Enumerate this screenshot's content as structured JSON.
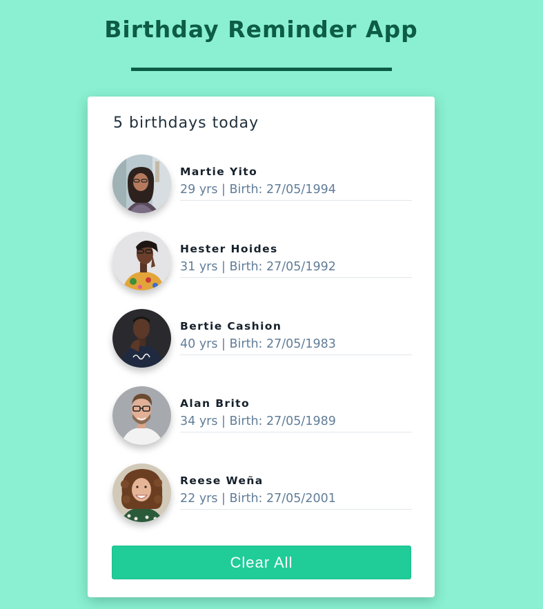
{
  "app": {
    "title": "Birthday Reminder App"
  },
  "summary": {
    "count_text": "5 birthdays today"
  },
  "people": [
    {
      "name": "Martie Yito",
      "info": "29 yrs | Birth: 27/05/1994",
      "avatar_icon": "woman-glasses-street-photo-icon"
    },
    {
      "name": "Hester Hoides",
      "info": "31 yrs | Birth: 27/05/1992",
      "avatar_icon": "woman-colorful-shirt-photo-icon"
    },
    {
      "name": "Bertie Cashion",
      "info": "40 yrs | Birth: 27/05/1983",
      "avatar_icon": "man-dark-tshirt-photo-icon"
    },
    {
      "name": "Alan Brito",
      "info": "34 yrs | Birth: 27/05/1989",
      "avatar_icon": "man-glasses-beard-photo-icon"
    },
    {
      "name": "Reese Weña",
      "info": "22 yrs | Birth: 27/05/2001",
      "avatar_icon": "woman-curly-hair-photo-icon"
    }
  ],
  "actions": {
    "clear_label": "Clear All"
  },
  "colors": {
    "background": "#8af0d1",
    "title": "#0d5c45",
    "button": "#20cc98",
    "info_text": "#617d98"
  }
}
